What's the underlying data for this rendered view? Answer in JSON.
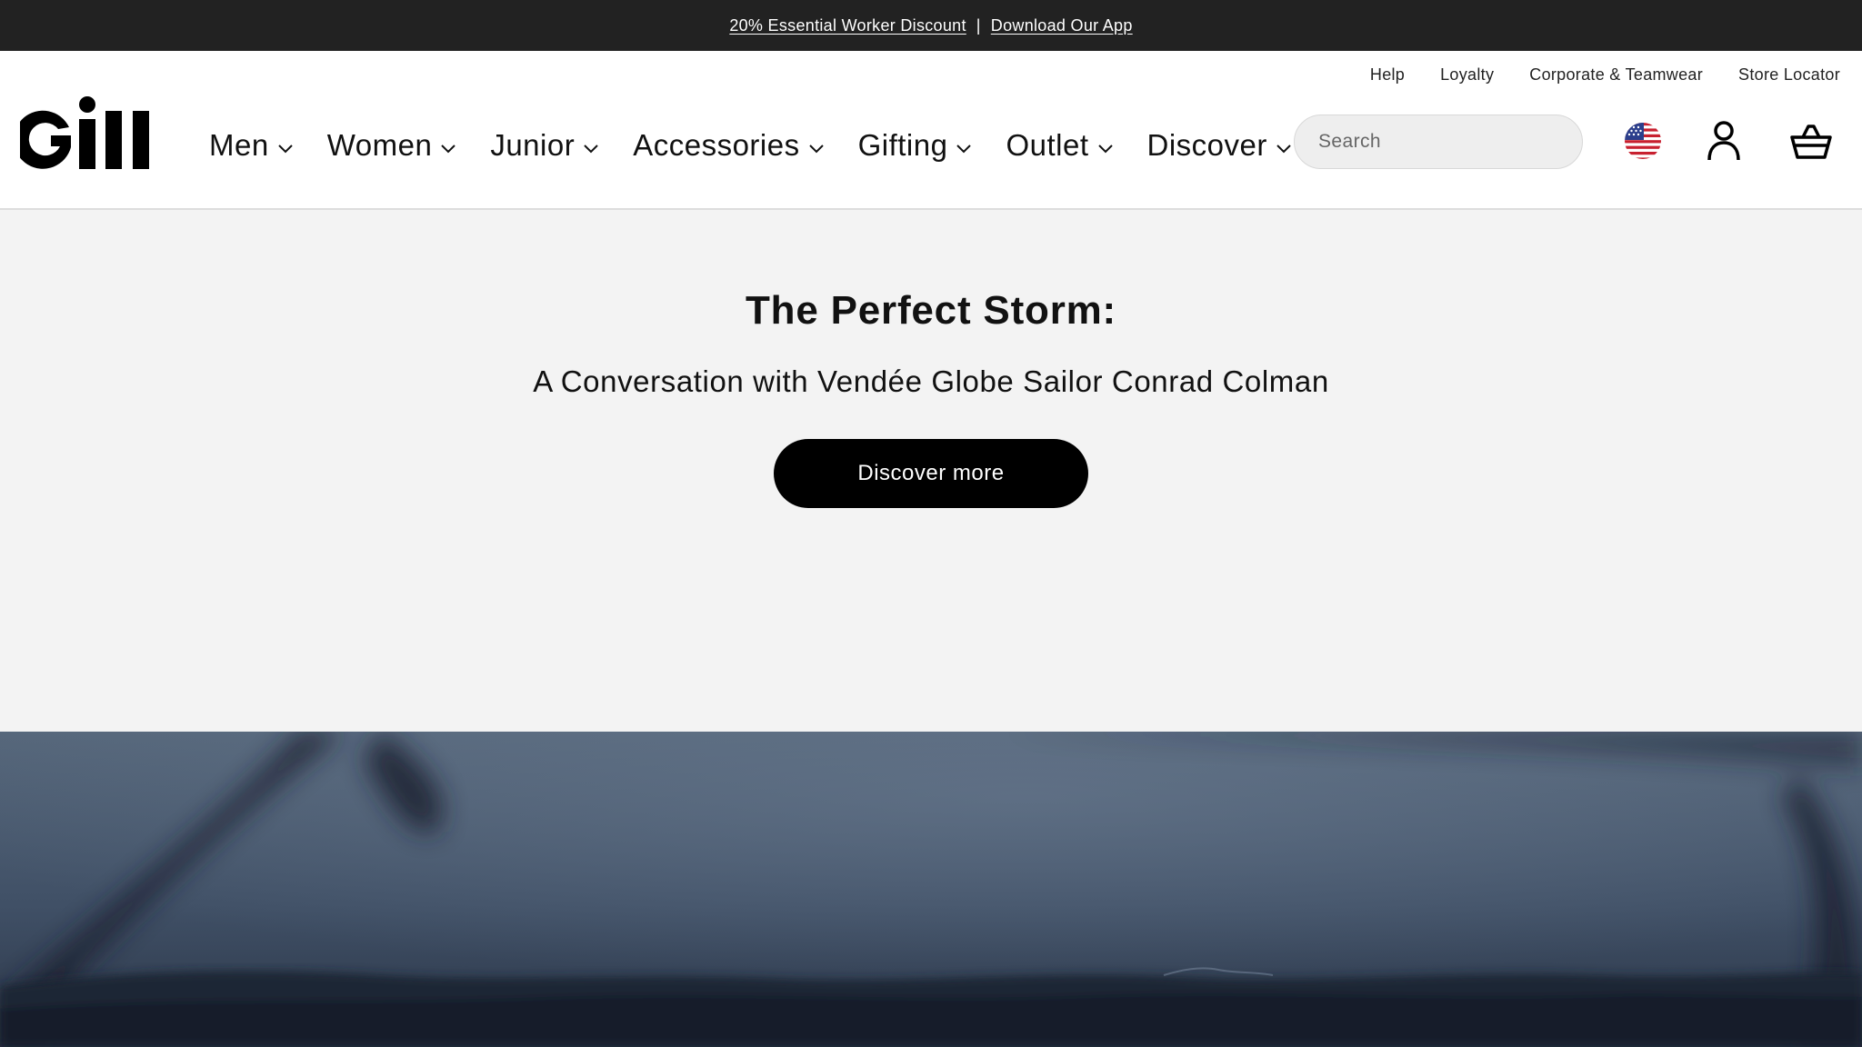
{
  "announcement": {
    "link1": "20% Essential Worker Discount",
    "separator": "|",
    "link2": "Download Our App"
  },
  "utility_nav": [
    "Help",
    "Loyalty",
    "Corporate & Teamwear",
    "Store Locator"
  ],
  "logo": {
    "text": "Gill"
  },
  "main_nav": [
    {
      "label": "Men"
    },
    {
      "label": "Women"
    },
    {
      "label": "Junior"
    },
    {
      "label": "Accessories"
    },
    {
      "label": "Gifting"
    },
    {
      "label": "Outlet"
    },
    {
      "label": "Discover"
    }
  ],
  "search": {
    "placeholder": "Search",
    "icon": "search-icon"
  },
  "header_icons": [
    "us-flag-icon",
    "account-icon",
    "basket-icon"
  ],
  "hero": {
    "title": "The Perfect Storm:",
    "subtitle": "A Conversation with Vendée Globe Sailor Conrad Colman",
    "cta_label": "Discover more"
  },
  "colors": {
    "announcement_bg": "#222222",
    "hero_bg": "#f3f3f3",
    "cta_bg": "#000000",
    "photo_tone": "#3e4d60"
  }
}
